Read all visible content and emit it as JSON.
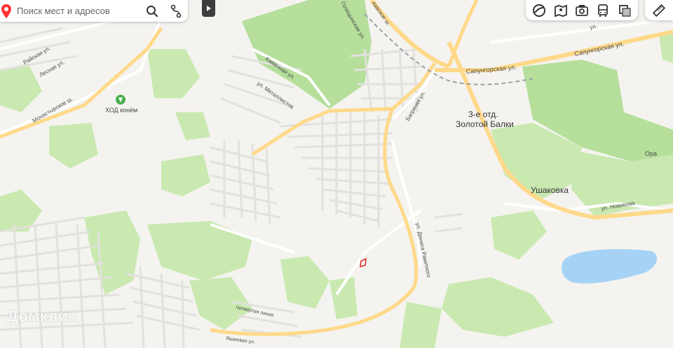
{
  "search": {
    "placeholder": "Поиск мест и адресов"
  },
  "colors": {
    "land": "#f4f3ef",
    "park": "#c9e9b0",
    "forest": "#b5df9b",
    "road": "#ffffff",
    "highway": "#ffd98a",
    "water": "#a6d3f5",
    "rail": "#9aa0a6"
  },
  "layers": [
    {
      "name": "satellite-icon"
    },
    {
      "name": "panorama-icon"
    },
    {
      "name": "camera-icon"
    },
    {
      "name": "transit-icon"
    },
    {
      "name": "layers-icon"
    }
  ],
  "ruler": {
    "name": "ruler-icon"
  },
  "map": {
    "places": {
      "golden_balka": [
        "3-е отд.",
        "Золотой Балки"
      ],
      "ushakovka": "Ушаковка",
      "khod": "ХОД конём"
    },
    "streets": {
      "sapungorskaya_top": "Сапунгорская ул.",
      "sapungorskaya": "Сапунгорская ул.",
      "monastyrskoe": "Монастырское ш.",
      "raiskaya": "Райская ул.",
      "lesnaya": "Лесная ул.",
      "kamennaya": "Каменная ул.",
      "metallistov": "ул. Металлистов",
      "bagryanaya": "Багряная ул.",
      "demin": "ул. Дениса Ракитного",
      "novikova": "ул. Новикова",
      "chetvertaya": "Четвёртая линия",
      "yashmovaya": "Яшмовая ул.",
      "golitsyn": "Голицынская ул.",
      "balak": "лавское ш.",
      "ul_right": "ул.",
      "ora": "Ора"
    },
    "watermark": "Домклик"
  }
}
